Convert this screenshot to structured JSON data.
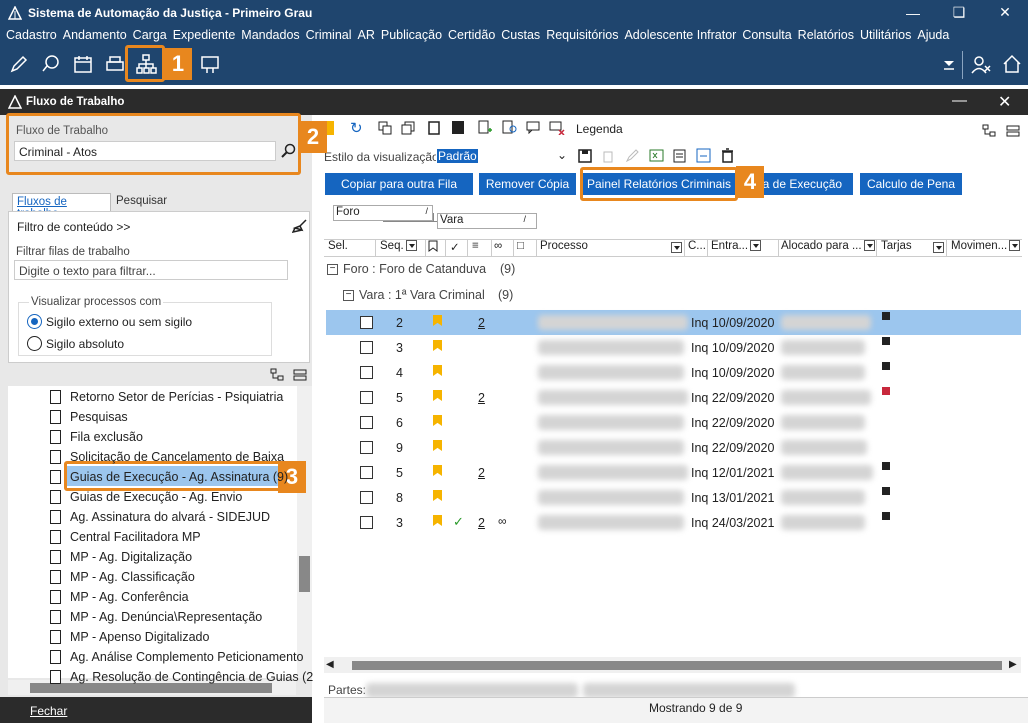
{
  "app": {
    "title": "Sistema de Automação da Justiça - Primeiro Grau",
    "menu": [
      "Cadastro",
      "Andamento",
      "Carga",
      "Expediente",
      "Mandados",
      "Criminal",
      "AR",
      "Publicação",
      "Certidão",
      "Custas",
      "Requisitórios",
      "Adolescente Infrator",
      "Consulta",
      "Relatórios",
      "Utilitários",
      "Ajuda"
    ]
  },
  "child": {
    "title": "Fluxo de Trabalho"
  },
  "left": {
    "fluxo_label": "Fluxo de Trabalho",
    "fluxo_value": "Criminal - Atos",
    "tabs": [
      "Fluxos de trabalho",
      "Pesquisar"
    ],
    "filtro_conteudo": "Filtro de conteúdo >>",
    "filtrar_label": "Filtrar filas de trabalho",
    "filtrar_placeholder": "Digite o texto para filtrar...",
    "visualizar_label": "Visualizar processos com",
    "radio1": "Sigilo externo ou sem sigilo",
    "radio2": "Sigilo absoluto",
    "tree": [
      "Retorno Setor de Perícias - Psiquiatria",
      "Pesquisas",
      "Fila exclusão",
      "Solicitação de Cancelamento de Baixa",
      "Guias de Execução - Ag. Assinatura (9)",
      "Guias de Execução - Ag. Envio",
      "Ag. Assinatura do alvará - SIDEJUD",
      "Central Facilitadora MP",
      "MP - Ag. Digitalização",
      "MP - Ag. Classificação",
      "MP - Ag. Conferência",
      "MP - Ag. Denúncia\\Representação",
      "MP - Apenso Digitalizado",
      "Ag. Análise Complemento Peticionamento",
      "Ag. Resolução de Contingência de Guias (2"
    ],
    "fechar": "Fechar"
  },
  "right": {
    "legenda": "Legenda",
    "estilo_label": "Estilo da visualização",
    "estilo_value": "Padrão",
    "buttons": [
      "Copiar para outra Fila",
      "Remover Cópia",
      "Painel Relatórios Criminais",
      "ia de Execução",
      "Calculo de Pena"
    ],
    "group1": "Foro",
    "group2": "Vara",
    "columns": [
      "Sel.",
      "Seq.",
      "Processo",
      "C...",
      "Entra...",
      "Alocado para ...",
      "Tarjas",
      "Movimen..."
    ],
    "foro_group": "Foro : Foro de Catanduva",
    "foro_count": "(9)",
    "vara_group": "Vara : 1ª Vara Criminal",
    "vara_count": "(9)",
    "rows": [
      {
        "seq": "2",
        "num": "2",
        "inq": "Inq 10/09/2020",
        "tarja": "#222"
      },
      {
        "seq": "3",
        "num": "",
        "inq": "Inq 10/09/2020",
        "tarja": "#222"
      },
      {
        "seq": "4",
        "num": "",
        "inq": "Inq 10/09/2020",
        "tarja": "#222"
      },
      {
        "seq": "5",
        "num": "2",
        "inq": "Inq 22/09/2020",
        "tarja": "#c8283c"
      },
      {
        "seq": "6",
        "num": "",
        "inq": "Inq 22/09/2020",
        "tarja": ""
      },
      {
        "seq": "9",
        "num": "",
        "inq": "Inq 22/09/2020",
        "tarja": ""
      },
      {
        "seq": "5",
        "num": "2",
        "inq": "Inq 12/01/2021",
        "tarja": "#222"
      },
      {
        "seq": "8",
        "num": "",
        "inq": "Inq 13/01/2021",
        "tarja": "#222"
      },
      {
        "seq": "3",
        "num": "2",
        "inq": "Inq 24/03/2021",
        "tarja": "#222"
      }
    ],
    "partes": "Partes:",
    "mostrando": "Mostrando 9 de 9"
  },
  "badges": [
    "1",
    "2",
    "3",
    "4"
  ],
  "colors": {
    "titlebar": "#1f456e",
    "accent": "#e8871e",
    "button": "#1565c0",
    "selected": "#9cc6ee"
  }
}
